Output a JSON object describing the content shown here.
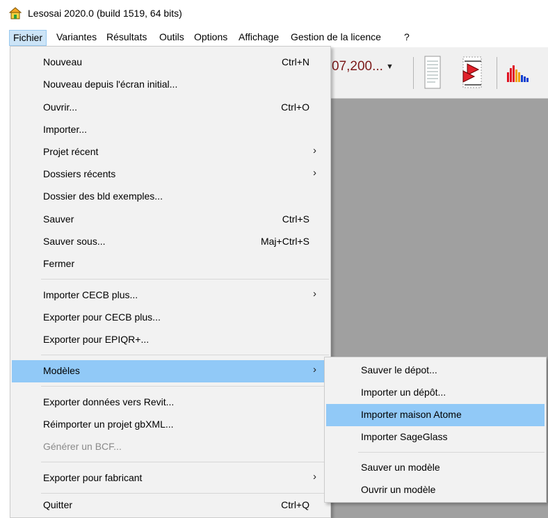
{
  "window": {
    "title": "Lesosai 2020.0 (build 1519, 64 bits)",
    "icon": "house-app-icon"
  },
  "menubar": {
    "items": [
      "Fichier",
      "Variantes",
      "Résultats",
      "Outils",
      "Options",
      "Affichage",
      "Gestion de la licence",
      "?"
    ],
    "active": "Fichier"
  },
  "toolbar": {
    "combo_value": "07,200...",
    "icons": [
      "report-icon",
      "red-arrows-icon",
      "bar-chart-icon"
    ]
  },
  "menu_fichier": {
    "items": [
      {
        "label": "Nouveau",
        "shortcut": "Ctrl+N"
      },
      {
        "label": "Nouveau depuis l'écran initial..."
      },
      {
        "label": "Ouvrir...",
        "shortcut": "Ctrl+O"
      },
      {
        "label": "Importer..."
      },
      {
        "label": "Projet récent",
        "submenu": "›"
      },
      {
        "label": "Dossiers récents",
        "submenu": "›"
      },
      {
        "label": "Dossier des bld exemples..."
      },
      {
        "label": "Sauver",
        "shortcut": "Ctrl+S"
      },
      {
        "label": "Sauver sous...",
        "shortcut": "Maj+Ctrl+S"
      },
      {
        "label": "Fermer"
      },
      {
        "label": "Importer CECB plus...",
        "submenu": "›"
      },
      {
        "label": "Exporter pour CECB plus..."
      },
      {
        "label": "Exporter pour EPIQR+..."
      },
      {
        "label": "Modèles",
        "submenu": "›",
        "highlighted": true
      },
      {
        "label": "Exporter données vers Revit..."
      },
      {
        "label": "Réimporter un projet gbXML..."
      },
      {
        "label": "Générer un BCF...",
        "disabled": true
      },
      {
        "label": "Exporter pour fabricant",
        "submenu": "›"
      },
      {
        "label": "Quitter",
        "shortcut": "Ctrl+Q"
      }
    ]
  },
  "submenu_modeles": {
    "items": [
      {
        "label": "Sauver le dépot..."
      },
      {
        "label": "Importer un dépôt..."
      },
      {
        "label": "Importer maison Atome",
        "highlighted": true
      },
      {
        "label": "Importer SageGlass"
      },
      {
        "label": "Sauver un modèle"
      },
      {
        "label": "Ouvrir un modèle"
      }
    ]
  },
  "colors": {
    "menu_highlight": "#91c9f7",
    "menubar_active": "#cce4f7",
    "workarea": "#a0a0a0",
    "combo_text": "#7c1a1a"
  }
}
